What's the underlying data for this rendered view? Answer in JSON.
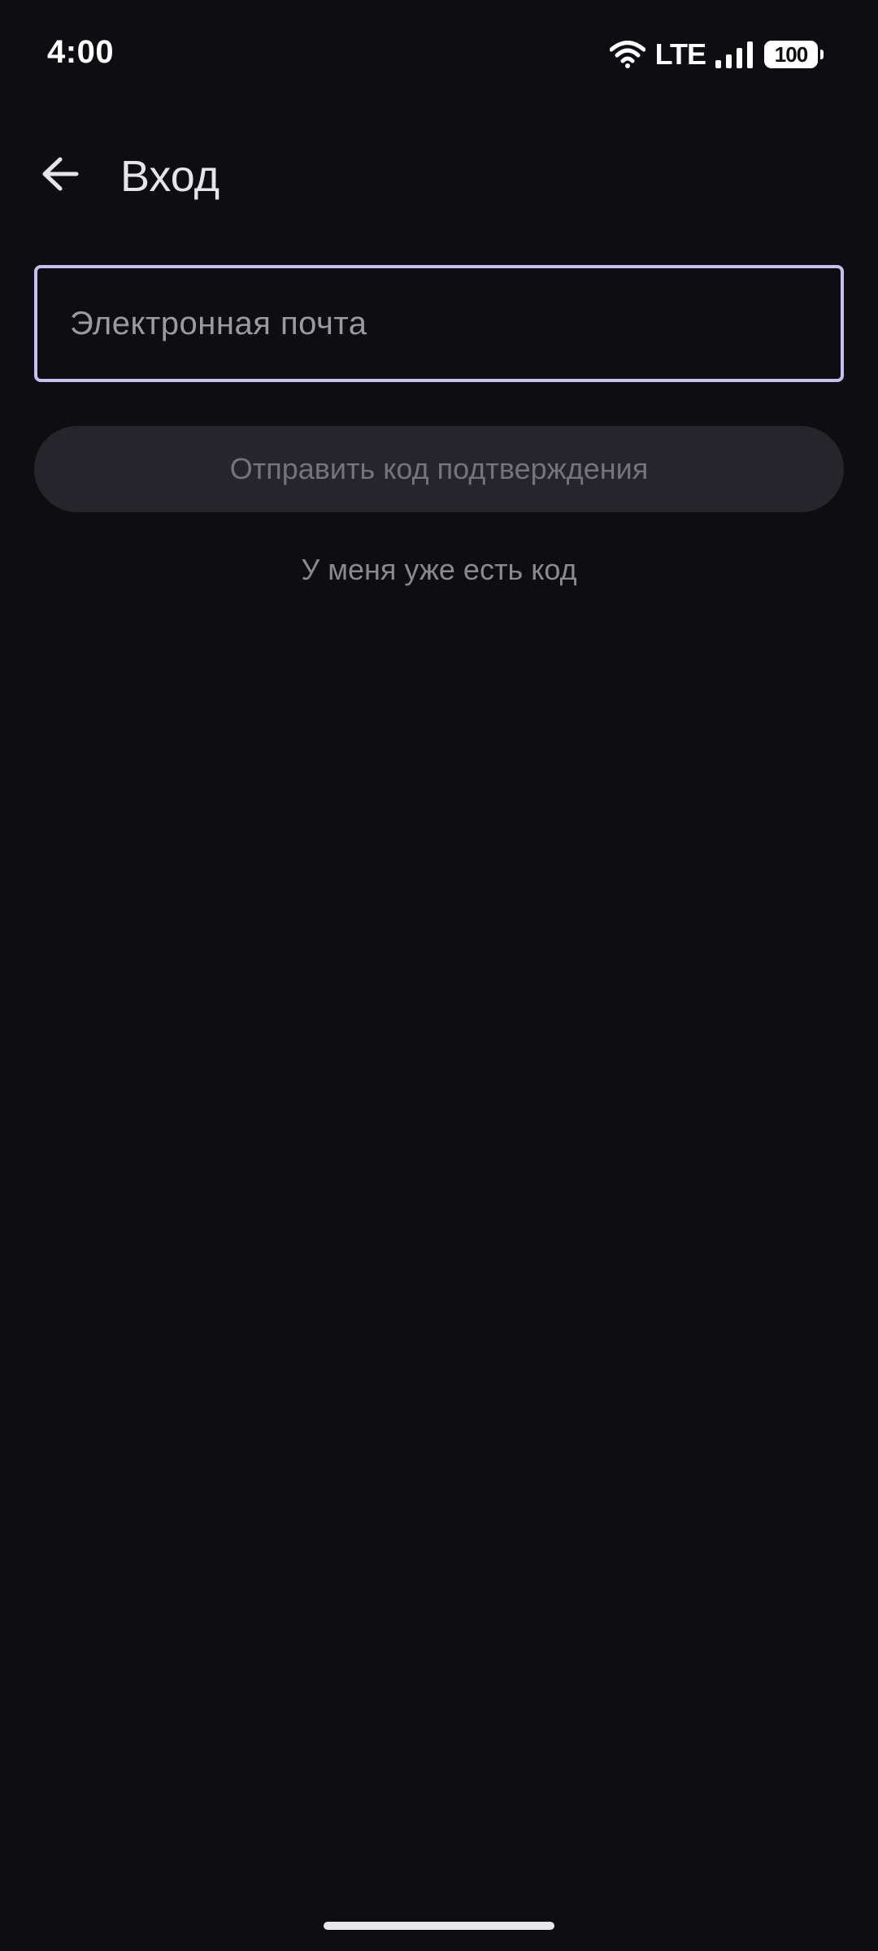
{
  "status_bar": {
    "time": "4:00",
    "network": "LTE",
    "battery": "100",
    "icons": [
      "wifi-icon",
      "signal-icon",
      "battery-icon"
    ]
  },
  "app_bar": {
    "back_icon": "arrow-left-icon",
    "title": "Вход"
  },
  "login_form": {
    "email": {
      "placeholder": "Электронная почта",
      "value": ""
    },
    "send_code_label": "Отправить код подтверждения",
    "have_code_label": "У меня уже есть код"
  },
  "colors": {
    "background": "#0e0e12",
    "field_border_focused": "#c5c0ee",
    "button_disabled_bg": "#25252b",
    "button_disabled_text": "#75747c"
  }
}
